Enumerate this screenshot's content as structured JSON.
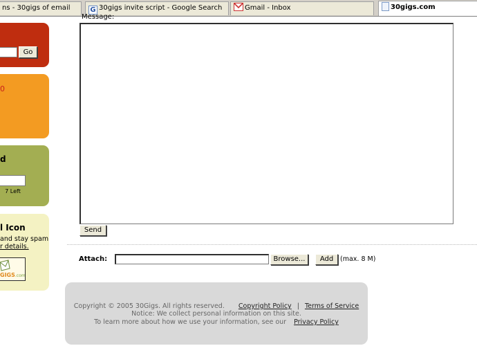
{
  "tabs": [
    {
      "label": "ns - 30gigs of email"
    },
    {
      "label": "30gigs invite script - Google Search",
      "icon": "google-icon"
    },
    {
      "label": "Gmail - Inbox",
      "icon": "gmail-icon"
    },
    {
      "label": "30gigs.com",
      "icon": "document-icon",
      "active": true
    }
  ],
  "sidebar": {
    "go_button": "Go",
    "orange_text": "0",
    "green_title": "d",
    "green_counter": "7 Left",
    "yellow_title": "l Icon",
    "yellow_line1": "and stay spam",
    "yellow_line2": "r details.",
    "logo_text": "GIGS",
    "logo_suffix": ".com"
  },
  "compose": {
    "message_label": "Message:",
    "message_value": "",
    "send_button": "Send"
  },
  "attach": {
    "label": "Attach:",
    "browse_button": "Browse...",
    "add_button": "Add",
    "max_note": "(max. 8 M)"
  },
  "footer": {
    "copyright": "Copyright © 2005 30Gigs. All rights reserved.",
    "copyright_policy": "Copyright Policy",
    "separator": "|",
    "terms": "Terms of Service",
    "notice": "Notice: We collect personal information on this site.",
    "learn_more": "To learn more about how we use your information, see our",
    "privacy": "Privacy Policy"
  },
  "colors": {
    "red_box": "#bf2d0f",
    "orange_box": "#f39b22",
    "green_box": "#a3ae52",
    "yellow_box": "#f4f2c3",
    "footer_bg": "#d9d9d9"
  }
}
